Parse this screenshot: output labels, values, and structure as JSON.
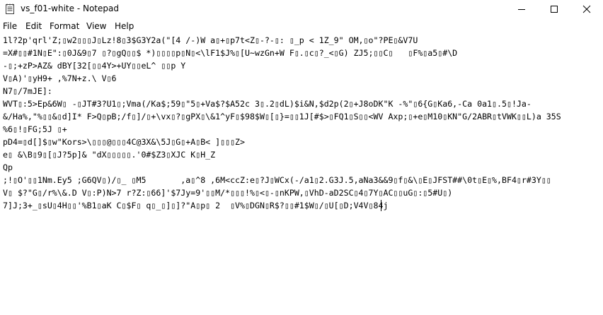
{
  "window": {
    "title": "vs_f01-white - Notepad"
  },
  "menu": [
    {
      "label": "File"
    },
    {
      "label": "Edit"
    },
    {
      "label": "Format"
    },
    {
      "label": "View"
    },
    {
      "label": "Help"
    }
  ],
  "editor": {
    "lines": [
      "1l?2p'qrl'Z;▯w2▯▯▯J▯Lz!8▯3$G3Y2a(\"[4 /-)W a▯+▯p7t<Z▯-?-▯: ▯_p < 1Z_9\" OM,▯o\"?PE▯&V7U",
      "=X#▯▯#1N▯E\":▯0J&9▯7 ▯?▯gQ▯▯$ *)▯▯▯▯p▯N▯<\\lF1$J%▯[U~wzGn+W F▯.▯c▯?_<▯G) ZJ5;▯▯C▯   ▯F%▯a5▯#\\D",
      "-▯;+zP>AZ& dBY[32[▯▯4Y>+UY▯▯eL^ ▯▯p Y",
      "V▯A)'▯yH9+ ,%7N+z.\\ V▯6",
      "N7▯/7mJE]:",
      "WVT▯:5>Ep&6W▯ -▯JT#3?U1▯;Vma(/Ka$;59▯\"5▯+Va$?$A52c 3▯.2▯dL)$i&N,$d2p(2▯+J8oDK\"K -%\"▯6{G▯Ka6,-Ca 0a1▯.5▯!Ja-",
      "&/Ha%,\"%▯▯&▯d]I* F>Q▯pB;/f▯]/▯+\\vx▯?▯gPX▯\\&1^yF▯$98$W▯[▯}=▯▯1J[#$>▯FQ1▯S▯▯<WV Axp;▯+e▯M10▯KN\"G/2ABR▯tVWK▯▯L)a 35S",
      "%6▯!▯FG;5J ▯+",
      "pD4=▯d[]$▯w\"Kors>\\▯▯▯@▯▯▯4C@3X&\\5J▯G▯+A▯B< ]▯▯▯Z>",
      "e▯ &\\B▯9▯[▯J?5p]& \"dX▯▯▯▯▯.'0#$Z3▯XJC K▯H_Z",
      "Qp",
      ";!▯O'▯▯1Nm.Ey5 ;G6QV▯)/▯_ ▯M5       ,a▯^8 ,6M<ccZ:e▯?J▯WCx(-/a1▯2.G3J.5,aNa3&&9▯f▯&\\▯E▯JFST##\\0t▯E▯%,BF4▯r#3Y▯▯",
      "V▯ $?\"G▯/r%\\&.D V▯:P)N>7 r?Z:▯66]'$7Jy=9'▯▯M/*▯▯▯!%▯<▯-▯nKPW,▯VhD-aD2SC▯4▯7Y▯AC▯▯uG▯:▯5#U▯)",
      "7]J;3+_▯sU▯4H▯▯'%B1▯aK C▯$F▯ q▯_▯]▯]?\"A▯p▯ 2  ▯V%▯DGN▯R$?▯▯#1$W▯/▯U[▯D;V4V▯84j"
    ]
  }
}
